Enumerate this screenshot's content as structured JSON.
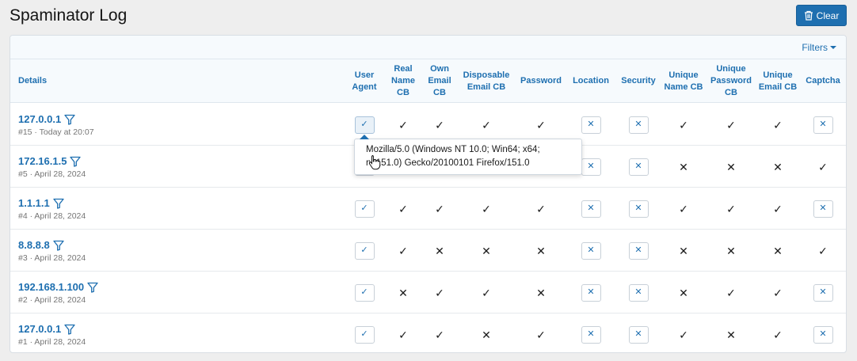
{
  "page": {
    "title": "Spaminator Log",
    "clear_label": "Clear",
    "filters_label": "Filters"
  },
  "columns": {
    "details": "Details",
    "user_agent": "User Agent",
    "real_name": "Real Name CB",
    "own_email": "Own Email CB",
    "disposable_email": "Disposable Email CB",
    "password": "Password",
    "location": "Location",
    "security": "Security",
    "unique_name": "Unique Name CB",
    "unique_password": "Unique Password CB",
    "unique_email": "Unique Email CB",
    "captcha": "Captcha"
  },
  "rows": [
    {
      "ip": "127.0.0.1",
      "meta": "#15 · Today at 20:07",
      "marks": {
        "real_name": "✓",
        "own_email": "✓",
        "disposable_email": "✓",
        "password": "✓",
        "unique_name": "✓",
        "unique_password": "✓",
        "unique_email": "✓"
      }
    },
    {
      "ip": "172.16.1.5",
      "meta": "#5 · April 28, 2024",
      "marks": {
        "unique_name": "✕",
        "unique_password": "✕",
        "unique_email": "✕",
        "captcha": "✓"
      }
    },
    {
      "ip": "1.1.1.1",
      "meta": "#4 · April 28, 2024",
      "marks": {
        "real_name": "✓",
        "own_email": "✓",
        "disposable_email": "✓",
        "password": "✓",
        "unique_name": "✓",
        "unique_password": "✓",
        "unique_email": "✓"
      }
    },
    {
      "ip": "8.8.8.8",
      "meta": "#3 · April 28, 2024",
      "marks": {
        "real_name": "✓",
        "own_email": "✕",
        "disposable_email": "✕",
        "password": "✕",
        "unique_name": "✕",
        "unique_password": "✕",
        "unique_email": "✕",
        "captcha": "✓"
      }
    },
    {
      "ip": "192.168.1.100",
      "meta": "#2 · April 28, 2024",
      "marks": {
        "real_name": "✕",
        "own_email": "✓",
        "disposable_email": "✓",
        "password": "✕",
        "unique_name": "✕",
        "unique_password": "✓",
        "unique_email": "✓"
      }
    },
    {
      "ip": "127.0.0.1",
      "meta": "#1 · April 28, 2024",
      "marks": {
        "real_name": "✓",
        "own_email": "✓",
        "disposable_email": "✕",
        "password": "✓",
        "unique_name": "✓",
        "unique_password": "✕",
        "unique_email": "✓"
      }
    }
  ],
  "tooltip": {
    "line1": "Mozilla/5.0 (Windows NT 10.0; Win64; x64;",
    "line2": "rv:151.0) Gecko/20100101 Firefox/151.0"
  },
  "icons": {
    "check_button": "✓",
    "cross_button": "✕",
    "filter": "funnel-icon",
    "trash": "trash-icon"
  },
  "colors": {
    "accent": "#1e6fb0",
    "text": "#141414",
    "muted": "#757575"
  }
}
